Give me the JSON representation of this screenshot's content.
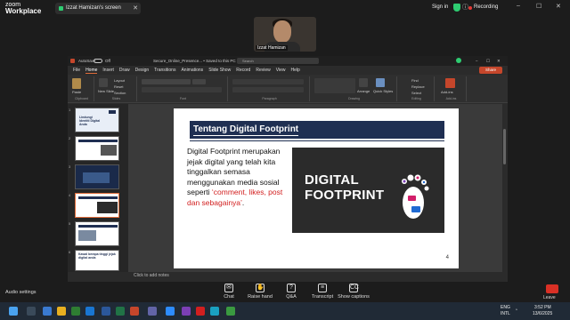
{
  "zoom": {
    "logo_top": "zoom",
    "logo_bottom": "Workplace",
    "screen_share_label": "Izzat Hamizan's screen",
    "sign_in": "Sign in",
    "recording": "Recording",
    "participant_name": "Izzat Hamizan",
    "audio_settings": "Audio settings",
    "toolbar": [
      {
        "label": "Chat",
        "icon": "chat-icon"
      },
      {
        "label": "Raise hand",
        "icon": "hand-icon"
      },
      {
        "label": "Q&A",
        "icon": "qa-icon"
      },
      {
        "label": "Transcript",
        "icon": "transcript-icon"
      },
      {
        "label": "Show captions",
        "icon": "cc-icon"
      }
    ],
    "leave": "Leave"
  },
  "ppt": {
    "autosave": "AutoSave",
    "autosave_state": "Off",
    "filename": "Secure_Online_Presence... • Saved to this PC",
    "search_placeholder": "Search",
    "tabs": [
      "File",
      "Home",
      "Insert",
      "Draw",
      "Design",
      "Transitions",
      "Animations",
      "Slide Show",
      "Record",
      "Review",
      "View",
      "Help"
    ],
    "active_tab": "Home",
    "share": "Share",
    "ribbon": {
      "paste": "Paste",
      "new_slide": "New Slide",
      "layout": "Layout",
      "reset": "Reset",
      "section": "Section",
      "arrange": "Arrange",
      "quick_styles": "Quick Styles",
      "find": "Find",
      "replace": "Replace",
      "select": "Select",
      "add_ins": "Add-ins",
      "groups": [
        "Clipboard",
        "Slides",
        "Font",
        "Paragraph",
        "Drawing",
        "Editing",
        "Add-ins"
      ]
    },
    "thumb_numbers": [
      "1",
      "2",
      "3",
      "4",
      "5",
      "6"
    ],
    "thumb1_text": "Lindungi Identiti Digital Anda",
    "thumb6_text": "Kawal berapa tinggi jejak digital anda",
    "notes_placeholder": "Click to add notes",
    "slide": {
      "title": "Tentang Digital Footprint",
      "body_black": "Digital Footprint merupakan jejak digital yang telah kita tinggalkan semasa menggunakan media sosial seperti ",
      "body_red": "‘comment, likes, post dan sebagainya’",
      "body_end": ".",
      "image_line1": "DIGITAL",
      "image_line2": "FOOTPRINT",
      "number": "4"
    }
  },
  "taskbar": {
    "lang": "ENG",
    "lang_sub": "INTL",
    "time": "3:52 PM",
    "date": "13/6/2025"
  }
}
